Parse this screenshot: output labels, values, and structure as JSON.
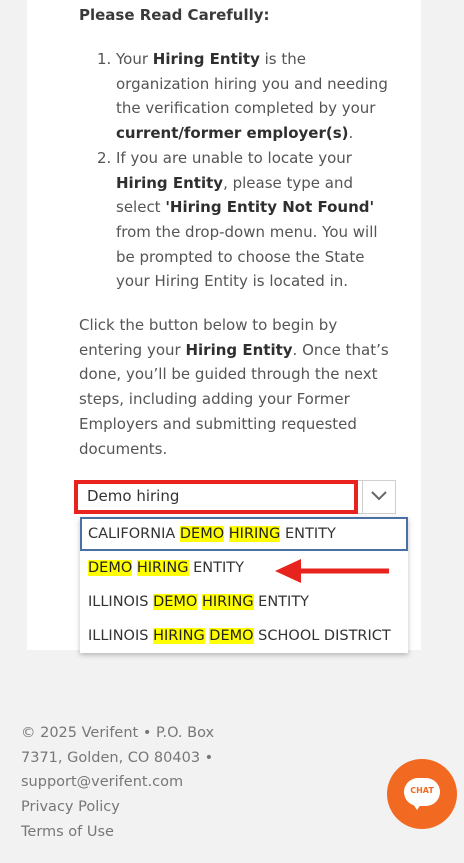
{
  "instructions": {
    "heading": "Please Read Carefully:",
    "step1": {
      "num": "1.",
      "pre": "Your ",
      "b1": "Hiring Entity",
      "mid": " is the organization hiring you and needing the verification completed by your ",
      "b2": "current/former employer(s)",
      "post": "."
    },
    "step2": {
      "num": "2.",
      "pre": "If you are unable to locate your ",
      "b1": "Hiring Entity",
      "mid": ", please type and select ",
      "b2": "'Hiring Entity Not Found'",
      "post": " from the drop-down menu. You will be prompted to choose the State your Hiring Entity is located in."
    },
    "para": {
      "pre": "Click the button below to begin by entering your ",
      "b": "Hiring Entity",
      "post": ". Once that’s done, you’ll be guided through the next steps, including adding your Former Employers and submitting requested documents."
    }
  },
  "search": {
    "value": "Demo hiring",
    "options": [
      [
        {
          "t": "CALIFORNIA ",
          "h": false
        },
        {
          "t": "DEMO",
          "h": true
        },
        {
          "t": " ",
          "h": false
        },
        {
          "t": "HIRING",
          "h": true
        },
        {
          "t": " ENTITY",
          "h": false
        }
      ],
      [
        {
          "t": "DEMO",
          "h": true
        },
        {
          "t": " ",
          "h": false
        },
        {
          "t": "HIRING",
          "h": true
        },
        {
          "t": " ENTITY",
          "h": false
        }
      ],
      [
        {
          "t": "ILLINOIS ",
          "h": false
        },
        {
          "t": "DEMO",
          "h": true
        },
        {
          "t": " ",
          "h": false
        },
        {
          "t": "HIRING",
          "h": true
        },
        {
          "t": " ENTITY",
          "h": false
        }
      ],
      [
        {
          "t": "ILLINOIS ",
          "h": false
        },
        {
          "t": "HIRING",
          "h": true
        },
        {
          "t": " ",
          "h": false
        },
        {
          "t": "DEMO",
          "h": true
        },
        {
          "t": " SCHOOL DISTRICT",
          "h": false
        }
      ]
    ]
  },
  "footer": {
    "line1": "© 2025 Verifent • P.O. Box",
    "line2": "7371, Golden, CO 80403 •",
    "email": "support@verifent.com",
    "privacy": "Privacy Policy",
    "terms": "Terms of Use"
  },
  "chat": {
    "label": "CHAT"
  },
  "colors": {
    "highlight": "#ffff00",
    "annotation_red": "#e8231e",
    "chat_orange": "#f26a21",
    "focus_border": "#4a6fa5"
  }
}
